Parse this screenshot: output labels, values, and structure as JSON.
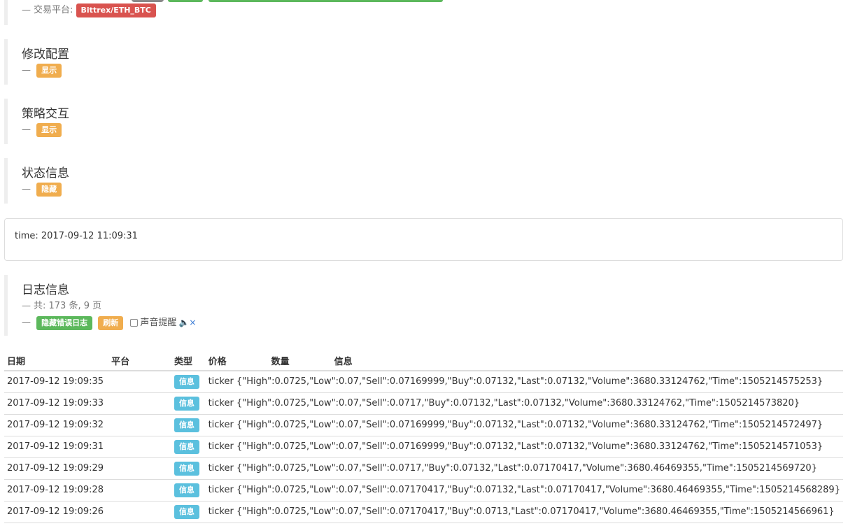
{
  "exchange": {
    "label": "交易平台:",
    "value": "Bittrex/ETH_BTC"
  },
  "sections": {
    "config": {
      "title": "修改配置",
      "toggle": "显示"
    },
    "interaction": {
      "title": "策略交互",
      "toggle": "显示"
    },
    "status": {
      "title": "状态信息",
      "toggle": "隐藏"
    }
  },
  "status_box": {
    "text": "time: 2017-09-12 11:09:31"
  },
  "log": {
    "title": "日志信息",
    "summary": "共: 173 条, 9 页",
    "hide_errors_label": "隐藏错误日志",
    "refresh_label": "刷新",
    "sound_label": "声音提醒",
    "sound_checked": false
  },
  "table": {
    "headers": [
      "日期",
      "平台",
      "类型",
      "价格",
      "数量",
      "信息"
    ],
    "rows": [
      {
        "date": "2017-09-12 19:09:35",
        "platform": "",
        "type": "信息",
        "price": "",
        "qty": "",
        "info": "ticker {\"High\":0.0725,\"Low\":0.07,\"Sell\":0.07169999,\"Buy\":0.07132,\"Last\":0.07132,\"Volume\":3680.33124762,\"Time\":1505214575253}"
      },
      {
        "date": "2017-09-12 19:09:33",
        "platform": "",
        "type": "信息",
        "price": "",
        "qty": "",
        "info": "ticker {\"High\":0.0725,\"Low\":0.07,\"Sell\":0.0717,\"Buy\":0.07132,\"Last\":0.07132,\"Volume\":3680.33124762,\"Time\":1505214573820}"
      },
      {
        "date": "2017-09-12 19:09:32",
        "platform": "",
        "type": "信息",
        "price": "",
        "qty": "",
        "info": "ticker {\"High\":0.0725,\"Low\":0.07,\"Sell\":0.07169999,\"Buy\":0.07132,\"Last\":0.07132,\"Volume\":3680.33124762,\"Time\":1505214572497}"
      },
      {
        "date": "2017-09-12 19:09:31",
        "platform": "",
        "type": "信息",
        "price": "",
        "qty": "",
        "info": "ticker {\"High\":0.0725,\"Low\":0.07,\"Sell\":0.07169999,\"Buy\":0.07132,\"Last\":0.07132,\"Volume\":3680.33124762,\"Time\":1505214571053}"
      },
      {
        "date": "2017-09-12 19:09:29",
        "platform": "",
        "type": "信息",
        "price": "",
        "qty": "",
        "info": "ticker {\"High\":0.0725,\"Low\":0.07,\"Sell\":0.0717,\"Buy\":0.07132,\"Last\":0.07170417,\"Volume\":3680.46469355,\"Time\":1505214569720}"
      },
      {
        "date": "2017-09-12 19:09:28",
        "platform": "",
        "type": "信息",
        "price": "",
        "qty": "",
        "info": "ticker {\"High\":0.0725,\"Low\":0.07,\"Sell\":0.07170417,\"Buy\":0.07132,\"Last\":0.07170417,\"Volume\":3680.46469355,\"Time\":1505214568289}"
      },
      {
        "date": "2017-09-12 19:09:26",
        "platform": "",
        "type": "信息",
        "price": "",
        "qty": "",
        "info": "ticker {\"High\":0.0725,\"Low\":0.07,\"Sell\":0.07170417,\"Buy\":0.0713,\"Last\":0.07170417,\"Volume\":3680.46469355,\"Time\":1505214566961}"
      }
    ]
  }
}
